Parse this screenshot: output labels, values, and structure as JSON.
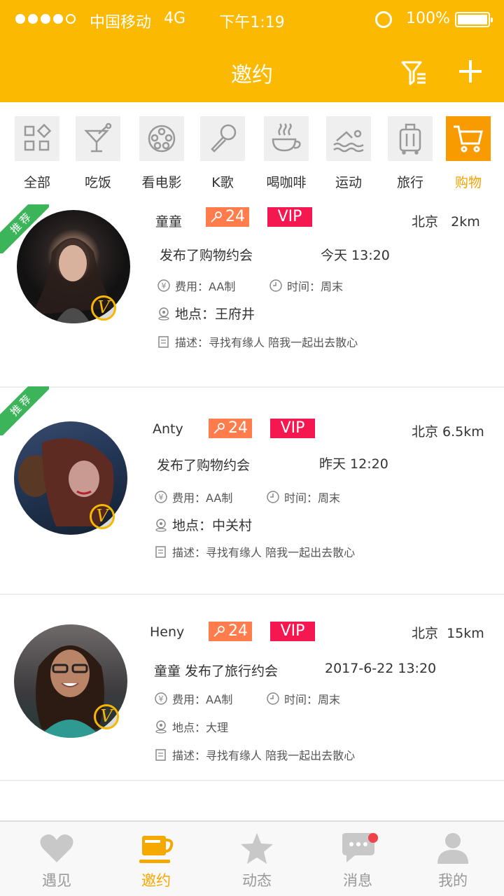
{
  "status_bar": {
    "carrier": "中国移动",
    "network": "4G",
    "time": "下午1:19",
    "battery": "100%"
  },
  "header": {
    "title": "邀约",
    "filter_icon": "filter-icon",
    "add_icon": "plus-icon"
  },
  "categories": [
    {
      "label": "全部",
      "icon": "grid-icon",
      "active": false
    },
    {
      "label": "吃饭",
      "icon": "cocktail-icon",
      "active": false
    },
    {
      "label": "看电影",
      "icon": "film-reel-icon",
      "active": false
    },
    {
      "label": "K歌",
      "icon": "microphone-icon",
      "active": false
    },
    {
      "label": "喝咖啡",
      "icon": "coffee-cup-icon",
      "active": false
    },
    {
      "label": "运动",
      "icon": "swimmer-icon",
      "active": false
    },
    {
      "label": "旅行",
      "icon": "suitcase-icon",
      "active": false
    },
    {
      "label": "购物",
      "icon": "shopping-cart-icon",
      "active": true
    }
  ],
  "posts": [
    {
      "ribbon": "推荐",
      "name": "童童",
      "likes": "24",
      "vip": "VIP",
      "location": "北京   2km",
      "headline": "发布了购物约会",
      "posted": "今天 13:20",
      "fee": "费用：AA制",
      "time": "时间：周末",
      "place": "地点：王府井",
      "desc": "描述：寻找有缘人 陪我一起出去散心",
      "badge": "V"
    },
    {
      "ribbon": "推荐",
      "name": "Anty",
      "likes": "24",
      "vip": "VIP",
      "location": "北京 6.5km",
      "headline": "发布了购物约会",
      "posted": "昨天 12:20",
      "fee": "费用：AA制",
      "time": "时间：周末",
      "place": "地点：中关村",
      "desc": "描述：寻找有缘人 陪我一起出去散心",
      "badge": "V"
    },
    {
      "name": "Heny",
      "likes": "24",
      "vip": "VIP",
      "location": "北京  15km",
      "headline": "童童 发布了旅行约会",
      "posted": "2017-6-22 13:20",
      "fee": "费用：AA制",
      "time": "时间：周末",
      "place": "地点：大理",
      "desc": "描述：寻找有缘人 陪我一起出去散心",
      "badge": "V"
    }
  ],
  "tabs": [
    {
      "label": "遇见",
      "icon": "heart-icon",
      "active": false
    },
    {
      "label": "邀约",
      "icon": "cup-icon",
      "active": true
    },
    {
      "label": "动态",
      "icon": "star-icon",
      "active": false
    },
    {
      "label": "消息",
      "icon": "chat-bubble-icon",
      "active": false,
      "unread_dot": true
    },
    {
      "label": "我的",
      "icon": "person-icon",
      "active": false
    }
  ],
  "colors": {
    "accent": "#FBB901",
    "active_category": "#F79B00",
    "vip": "#F5174F",
    "likes": "#FF7D4C",
    "ribbon": "#3CB55A"
  }
}
